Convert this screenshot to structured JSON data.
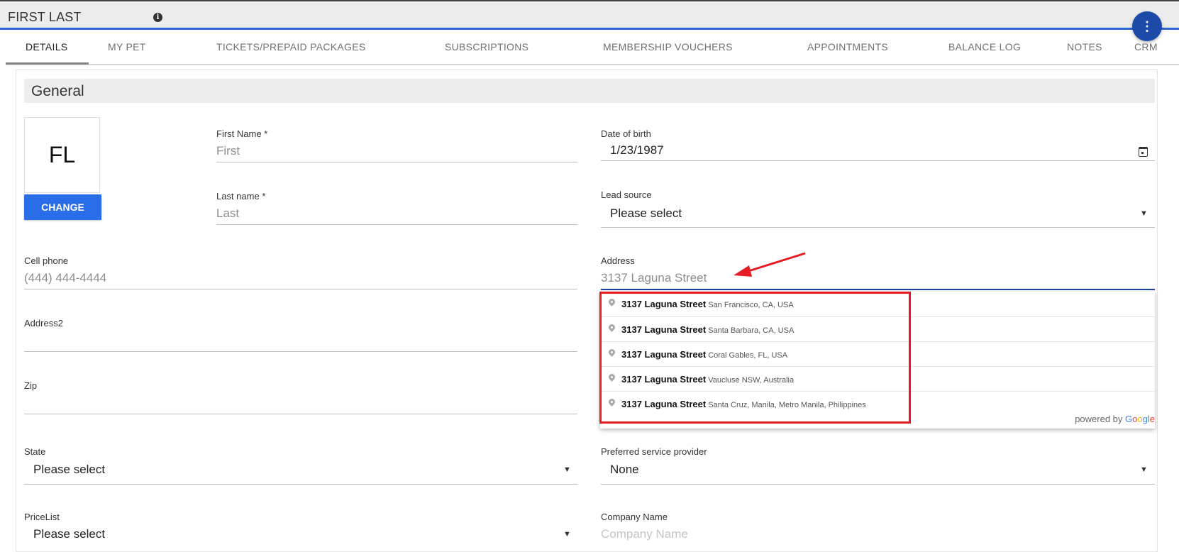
{
  "header": {
    "title": "FIRST LAST",
    "info_icon": "info-icon",
    "fab_icon": "more-vert-icon",
    "fab_glyph": "⋮"
  },
  "tabs": [
    {
      "label": "DETAILS"
    },
    {
      "label": "MY PET"
    },
    {
      "label": "TICKETS/PREPAID PACKAGES"
    },
    {
      "label": "SUBSCRIPTIONS"
    },
    {
      "label": "MEMBERSHIP VOUCHERS"
    },
    {
      "label": "APPOINTMENTS"
    },
    {
      "label": "BALANCE LOG"
    },
    {
      "label": "NOTES"
    },
    {
      "label": "CRM"
    }
  ],
  "section": {
    "title": "General"
  },
  "avatar": {
    "initials": "FL",
    "change_label": "CHANGE"
  },
  "fields": {
    "first_name": {
      "label": "First Name *",
      "placeholder": "First"
    },
    "last_name": {
      "label": "Last name *",
      "placeholder": "Last"
    },
    "dob": {
      "label": "Date of birth",
      "value": "1/23/1987"
    },
    "lead_source": {
      "label": "Lead source",
      "value": "Please select"
    },
    "cell_phone": {
      "label": "Cell phone",
      "placeholder": "(444) 444-4444"
    },
    "address": {
      "label": "Address",
      "value": "3137 Laguna Street"
    },
    "address2": {
      "label": "Address2"
    },
    "zip": {
      "label": "Zip"
    },
    "state": {
      "label": "State",
      "value": "Please select"
    },
    "preferred_provider": {
      "label": "Preferred service provider",
      "value": "None"
    },
    "pricelist": {
      "label": "PriceList",
      "value": "Please select"
    },
    "company": {
      "label": "Company Name",
      "placeholder": "Company Name"
    }
  },
  "suggestions": [
    {
      "main": "3137 Laguna Street",
      "secondary": "San Francisco, CA, USA"
    },
    {
      "main": "3137 Laguna Street",
      "secondary": "Santa Barbara, CA, USA"
    },
    {
      "main": "3137 Laguna Street",
      "secondary": "Coral Gables, FL, USA"
    },
    {
      "main": "3137 Laguna Street",
      "secondary": "Vaucluse NSW, Australia"
    },
    {
      "main": "3137 Laguna Street",
      "secondary": "Santa Cruz, Manila, Metro Manila, Philippines"
    }
  ],
  "powered_by": {
    "prefix": "powered by",
    "g1": "G",
    "g2": "o",
    "g3": "o",
    "g4": "g",
    "g5": "l",
    "g6": "e"
  },
  "colors": {
    "accent": "#2a6de8",
    "highlight": "#e51c23",
    "active_underline": "#1a43a3"
  }
}
